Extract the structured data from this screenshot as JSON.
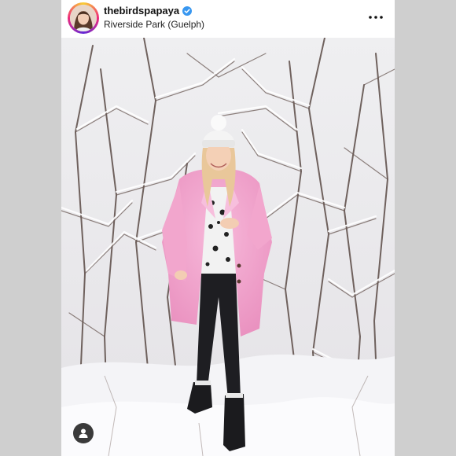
{
  "post": {
    "username": "thebirdspapaya",
    "location": "Riverside Park (Guelph)",
    "verified": true
  },
  "icons": {
    "verified": "verified-badge-icon",
    "more": "more-options-icon",
    "tag": "user-tag-icon"
  },
  "colors": {
    "verified_blue": "#3897f0",
    "coat_pink": "#f4a8cf",
    "story_ring": "#ee2a7b"
  }
}
